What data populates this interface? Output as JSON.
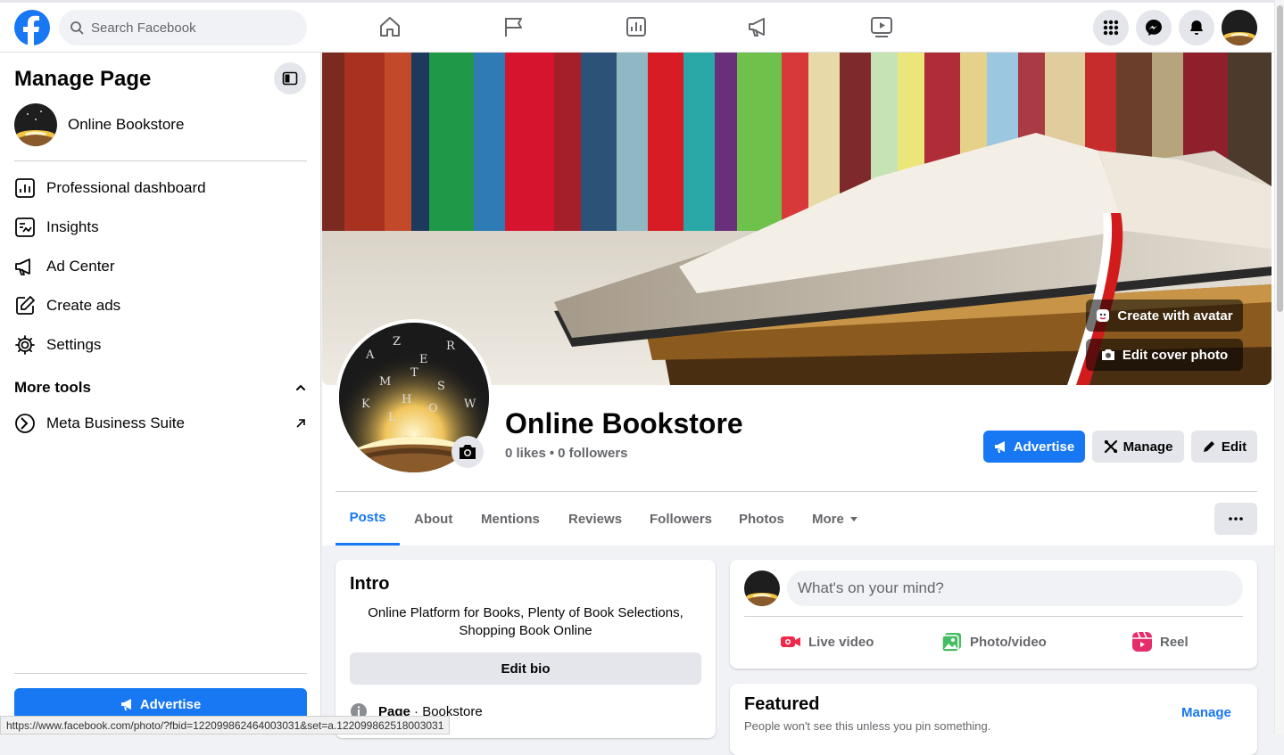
{
  "topbar": {
    "search_placeholder": "Search Facebook",
    "nav_icons": [
      "home-icon",
      "pages-flag-icon",
      "insights-icon",
      "ads-megaphone-icon",
      "watch-icon"
    ],
    "right_icons": [
      "menu-grid-icon",
      "messenger-icon",
      "notifications-bell-icon"
    ]
  },
  "sidebar": {
    "title": "Manage Page",
    "page_name": "Online Bookstore",
    "items": [
      {
        "label": "Professional dashboard",
        "icon": "dashboard-icon"
      },
      {
        "label": "Insights",
        "icon": "insights-icon"
      },
      {
        "label": "Ad Center",
        "icon": "megaphone-icon"
      },
      {
        "label": "Create ads",
        "icon": "pencil-square-icon"
      },
      {
        "label": "Settings",
        "icon": "gear-icon"
      }
    ],
    "more_tools": "More tools",
    "meta_business": "Meta Business Suite",
    "advertise": "Advertise"
  },
  "cover": {
    "create_avatar": "Create with avatar",
    "edit_cover": "Edit cover photo"
  },
  "profile": {
    "name": "Online Bookstore",
    "likes": "0 likes",
    "separator": "•",
    "followers": "0 followers",
    "advertise": "Advertise",
    "manage": "Manage",
    "edit": "Edit"
  },
  "tabs": [
    "Posts",
    "About",
    "Mentions",
    "Reviews",
    "Followers",
    "Photos",
    "More"
  ],
  "intro": {
    "title": "Intro",
    "bio": "Online Platform for Books, Plenty of Book Selections, Shopping Book Online",
    "edit_bio": "Edit bio",
    "page_label": "Page",
    "page_sep": " · ",
    "category": "Bookstore"
  },
  "composer": {
    "placeholder": "What's on your mind?",
    "live": "Live video",
    "photo": "Photo/video",
    "reel": "Reel"
  },
  "featured": {
    "title": "Featured",
    "subtitle": "People won't see this unless you pin something.",
    "manage": "Manage"
  },
  "status_url": "https://www.facebook.com/photo/?fbid=122099862464003031&set=a.122099862518003031",
  "colors": {
    "brand": "#1877f2",
    "bg": "#f0f2f5",
    "secondary_text": "#65676b"
  }
}
